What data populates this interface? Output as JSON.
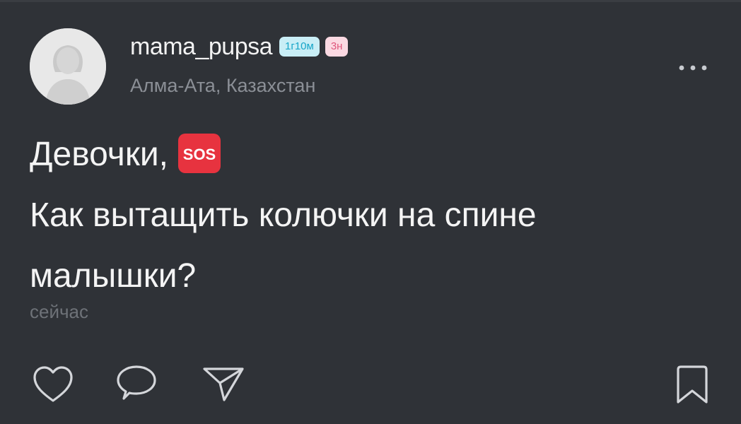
{
  "post": {
    "author": {
      "username": "mama_pupsa",
      "child_age_badge": "1г10м",
      "trimester_badge": "3н",
      "location": "Алма-Ата, Казахстан"
    },
    "text_lines": [
      "Девочки,",
      "Как вытащить колючки на спине",
      "малышки?"
    ],
    "emoji": "SOS",
    "timestamp": "сейчас"
  },
  "icons": {
    "avatar": "user-silhouette",
    "more": "ellipsis-icon",
    "like": "heart-icon",
    "comment": "speech-bubble-icon",
    "share": "paper-plane-icon",
    "bookmark": "bookmark-icon"
  },
  "colors": {
    "background": "#2f3237",
    "text_primary": "#f4f4f4",
    "text_secondary": "#8b8f96",
    "age_badge_bg": "#c9eef6",
    "age_badge_fg": "#17a6c8",
    "kids_badge_bg": "#fbd9e2",
    "kids_badge_fg": "#e0587d",
    "sos_red": "#e7333f"
  }
}
